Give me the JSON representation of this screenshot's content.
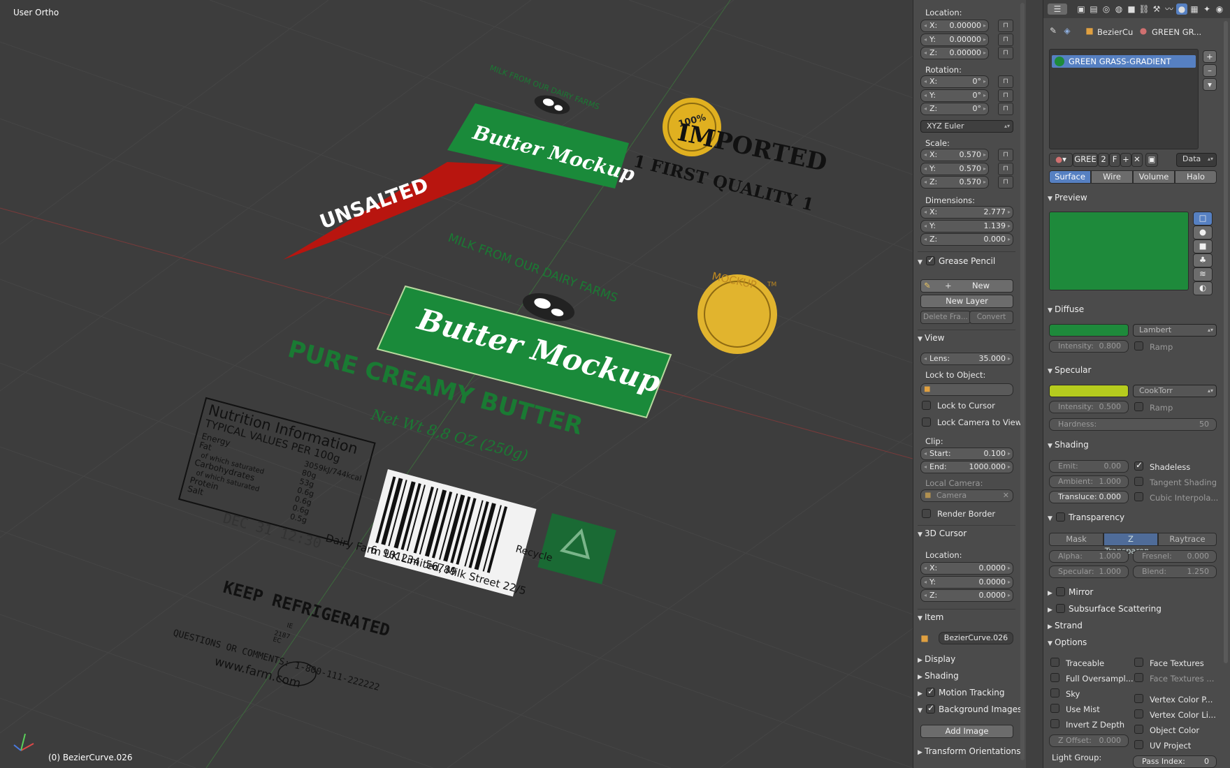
{
  "viewport": {
    "title": "User Ortho",
    "status": "(0) BezierCurve.026",
    "artwork": {
      "unsalted": "UNSALTED",
      "arc_small": "MILK FROM OUR DAIRY FARMS",
      "arc_large": "MILK FROM OUR DAIRY FARMS",
      "logo_small": "Butter Mockup",
      "logo_large": "Butter Mockup",
      "imported": "IMPORTED",
      "first_quality": "1 FIRST QUALITY 1",
      "badge_text": "100%",
      "seal_text": "MOCKUP",
      "seal_tm": "TM",
      "pure_creamy": "PURE CREAMY BUTTER",
      "net_wt": "Net Wt 8,8 OZ (250g)",
      "nutrition_title": "Nutrition Information",
      "nutrition_sub": "TYPICAL VALUES PER 100g",
      "nutrition_rows": [
        [
          "Energy",
          "3059kJ/744kcal"
        ],
        [
          "Fat",
          "80g"
        ],
        [
          "of which saturated",
          "53g"
        ],
        [
          "Carbohydrates",
          "0.6g"
        ],
        [
          "of which saturated",
          "0.6g"
        ],
        [
          "Protein",
          "0.6g"
        ],
        [
          "Salt",
          "0.5g"
        ]
      ],
      "date": "DEC 31 12:30",
      "barcode_digits": "6 901234 56789",
      "address": "Dairy Farm UK Limited, Milk Street 22/5",
      "recycle": "Recycle",
      "keep": "KEEP REFRIGERATED",
      "codes": [
        "IE",
        "2187",
        "EC"
      ],
      "questions": "QUESTIONS OR COMMENTS: 1-800-111-222222",
      "website": "www.farm.com"
    }
  },
  "npanel": {
    "location_label": "Location:",
    "location": [
      {
        "axis": "X:",
        "val": "0.00000"
      },
      {
        "axis": "Y:",
        "val": "0.00000"
      },
      {
        "axis": "Z:",
        "val": "0.00000"
      }
    ],
    "rotation_label": "Rotation:",
    "rotation": [
      {
        "axis": "X:",
        "val": "0°"
      },
      {
        "axis": "Y:",
        "val": "0°"
      },
      {
        "axis": "Z:",
        "val": "0°"
      }
    ],
    "rotation_mode": "XYZ Euler",
    "scale_label": "Scale:",
    "scale": [
      {
        "axis": "X:",
        "val": "0.570"
      },
      {
        "axis": "Y:",
        "val": "0.570"
      },
      {
        "axis": "Z:",
        "val": "0.570"
      }
    ],
    "dimensions_label": "Dimensions:",
    "dimensions": [
      {
        "axis": "X:",
        "val": "2.777"
      },
      {
        "axis": "Y:",
        "val": "1.139"
      },
      {
        "axis": "Z:",
        "val": "0.000"
      }
    ],
    "grease_pencil": "Grease Pencil",
    "gp_new": "New",
    "gp_new_layer": "New Layer",
    "gp_delete_frame": "Delete Fra...",
    "gp_convert": "Convert",
    "view": "View",
    "lens_label": "Lens:",
    "lens_val": "35.000",
    "lock_to_object": "Lock to Object:",
    "lock_to_cursor": "Lock to Cursor",
    "lock_camera": "Lock Camera to View",
    "clip": "Clip:",
    "clip_start_label": "Start:",
    "clip_start": "0.100",
    "clip_end_label": "End:",
    "clip_end": "1000.000",
    "local_camera": "Local Camera:",
    "camera": "Camera",
    "render_border": "Render Border",
    "cursor_3d": "3D Cursor",
    "cursor_location": "Location:",
    "cursor": [
      {
        "axis": "X:",
        "val": "0.0000"
      },
      {
        "axis": "Y:",
        "val": "0.0000"
      },
      {
        "axis": "Z:",
        "val": "0.0000"
      }
    ],
    "item": "Item",
    "item_name": "BezierCurve.026",
    "display": "Display",
    "shading": "Shading",
    "motion_tracking": "Motion Tracking",
    "background_images": "Background Images",
    "add_image": "Add Image",
    "transform_orientations": "Transform Orientations"
  },
  "props": {
    "breadcrumb_obj": "BezierCu",
    "breadcrumb_mat": "GREEN GR...",
    "material_slot": "GREEN GRASS-GRADIENT",
    "mat_name": "GREE",
    "mat_users": "2",
    "mat_fake": "F",
    "link": "Data",
    "tabs": [
      "Surface",
      "Wire",
      "Volume",
      "Halo"
    ],
    "preview": "Preview",
    "preview_color": "#1e8a3b",
    "diffuse": "Diffuse",
    "diffuse_color": "#1e8a3b",
    "diffuse_shader": "Lambert",
    "diffuse_intensity_label": "Intensity:",
    "diffuse_intensity": "0.800",
    "ramp": "Ramp",
    "specular": "Specular",
    "specular_color": "#b6cc1e",
    "specular_shader": "CookTorr",
    "specular_intensity_label": "Intensity:",
    "specular_intensity": "0.500",
    "hardness_label": "Hardness:",
    "hardness": "50",
    "shading": "Shading",
    "emit_label": "Emit:",
    "emit": "0.00",
    "shadeless": "Shadeless",
    "ambient_label": "Ambient:",
    "ambient": "1.000",
    "tangent_shading": "Tangent Shading",
    "translucency_label": "Transluce:",
    "translucency": "0.000",
    "cubic": "Cubic Interpola...",
    "transparency": "Transparency",
    "trans_tabs": [
      "Mask",
      "Z Transparen...",
      "Raytrace"
    ],
    "alpha_label": "Alpha:",
    "alpha": "1.000",
    "fresnel_label": "Fresnel:",
    "fresnel": "0.000",
    "spec_label": "Specular:",
    "spec": "1.000",
    "blend_label": "Blend:",
    "blend": "1.250",
    "mirror": "Mirror",
    "sss": "Subsurface Scattering",
    "strand": "Strand",
    "options": "Options",
    "opt_left": [
      "Traceable",
      "Full Oversampl...",
      "Sky",
      "Use Mist",
      "Invert Z Depth"
    ],
    "opt_right": [
      "Face Textures",
      "Face Textures ...",
      "Vertex Color P...",
      "Vertex Color Li...",
      "Object Color",
      "UV Project"
    ],
    "z_offset_label": "Z Offset:",
    "z_offset": "0.000",
    "light_group": "Light Group:",
    "pass_index_label": "Pass Index:",
    "pass_index": "0"
  }
}
